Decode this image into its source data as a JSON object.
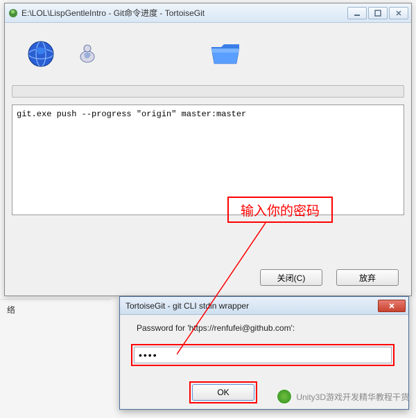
{
  "main_window": {
    "title": "E:\\LOL\\LispGentleIntro - Git命令进度 - TortoiseGit",
    "output": "git.exe push --progress  \"origin\" master:master",
    "buttons": {
      "close": "关闭(C)",
      "abort": "放弃"
    }
  },
  "annotation": {
    "text": "输入你的密码"
  },
  "password_dialog": {
    "title": "TortoiseGit -  git CLI stdin wrapper",
    "label": "Password for 'https://renfufei@github.com':",
    "value": "••••",
    "ok": "OK"
  },
  "sidebar": {
    "item1": "络"
  },
  "watermark": {
    "text": "Unity3D游戏开发精华教程干货"
  }
}
